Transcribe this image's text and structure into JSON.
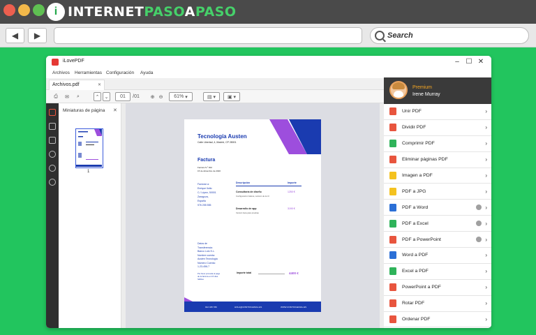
{
  "browser": {
    "logo_mark": "i",
    "logo_text_a": "INTERNET",
    "logo_text_b": "PASO",
    "logo_text_c": "A",
    "logo_text_d": "PASO",
    "back": "◀",
    "forward": "▶",
    "search_placeholder": "Search"
  },
  "app": {
    "title": "iLovePDF",
    "menu": [
      "Archivos",
      "Herramientas",
      "Configuración",
      "Ayuda"
    ],
    "tab": "Archivos.pdf",
    "page_current": "01",
    "page_total": "/01",
    "zoom": "61%",
    "thumbnails": {
      "header": "Miniaturas de página",
      "page_num": "1"
    }
  },
  "pdf": {
    "company": "Tecnología Austen",
    "address": "Calle Libertad, 4, Madrid, CP 28001",
    "title": "Factura",
    "meta_1": "Factura N.º 002",
    "meta_2": "15 de diciembre de 2020",
    "bill_to": [
      "Facturar a:",
      "Enrique Ilotto",
      "C./ López, 50001",
      "Zaragoza,",
      "España",
      "976 255 555"
    ],
    "col_desc": "Descripción",
    "col_amount": "Importe",
    "item1": "Consultoría de diseño",
    "item1_sub": "Configuración básica, revisión de la UI",
    "item1_price": "1250 €",
    "item2": "Desarrollo de app",
    "item2_sub": "Versión beta para pruebas",
    "item2_price": "3190 €",
    "bank": [
      "Datos de",
      "Transferencia",
      "Banco Lolo S.L.",
      "Nombre cuenta:",
      "Austen Tecnología",
      "Número Cuenta:",
      "1-23-456-7"
    ],
    "pay_note": [
      "Por favor proceda al pago",
      "de la factura en 15 días",
      "hábiles"
    ],
    "total_label": "Importe total",
    "total_value": "4400 €",
    "footer_phone": "912 345 789",
    "footer_email": "HOLA@UNSITIOGENIAL.ES",
    "footer_web": "WWW.UNSITIOGENIAL.ES"
  },
  "panel": {
    "premium_label": "Premium",
    "user": "Irene Murray",
    "tools": [
      {
        "label": "Unir PDF",
        "color": "#e8553e",
        "premium": false
      },
      {
        "label": "Dividir PDF",
        "color": "#e8553e",
        "premium": false
      },
      {
        "label": "Comprimir PDF",
        "color": "#2fb35a",
        "premium": false
      },
      {
        "label": "Eliminar páginas PDF",
        "color": "#e8553e",
        "premium": false
      },
      {
        "label": "Imagen a PDF",
        "color": "#f4c21f",
        "premium": false
      },
      {
        "label": "PDF a JPG",
        "color": "#f4c21f",
        "premium": false
      },
      {
        "label": "PDF a Word",
        "color": "#2b6fd6",
        "premium": true
      },
      {
        "label": "PDF a Excel",
        "color": "#2fb35a",
        "premium": true
      },
      {
        "label": "PDF a PowerPoint",
        "color": "#e8553e",
        "premium": true
      },
      {
        "label": "Word a PDF",
        "color": "#2b6fd6",
        "premium": false
      },
      {
        "label": "Excel a PDF",
        "color": "#2fb35a",
        "premium": false
      },
      {
        "label": "PowerPoint a PDF",
        "color": "#e8553e",
        "premium": false
      },
      {
        "label": "Rotar PDF",
        "color": "#e8553e",
        "premium": false
      },
      {
        "label": "Ordenar PDF",
        "color": "#e8553e",
        "premium": false
      }
    ]
  }
}
